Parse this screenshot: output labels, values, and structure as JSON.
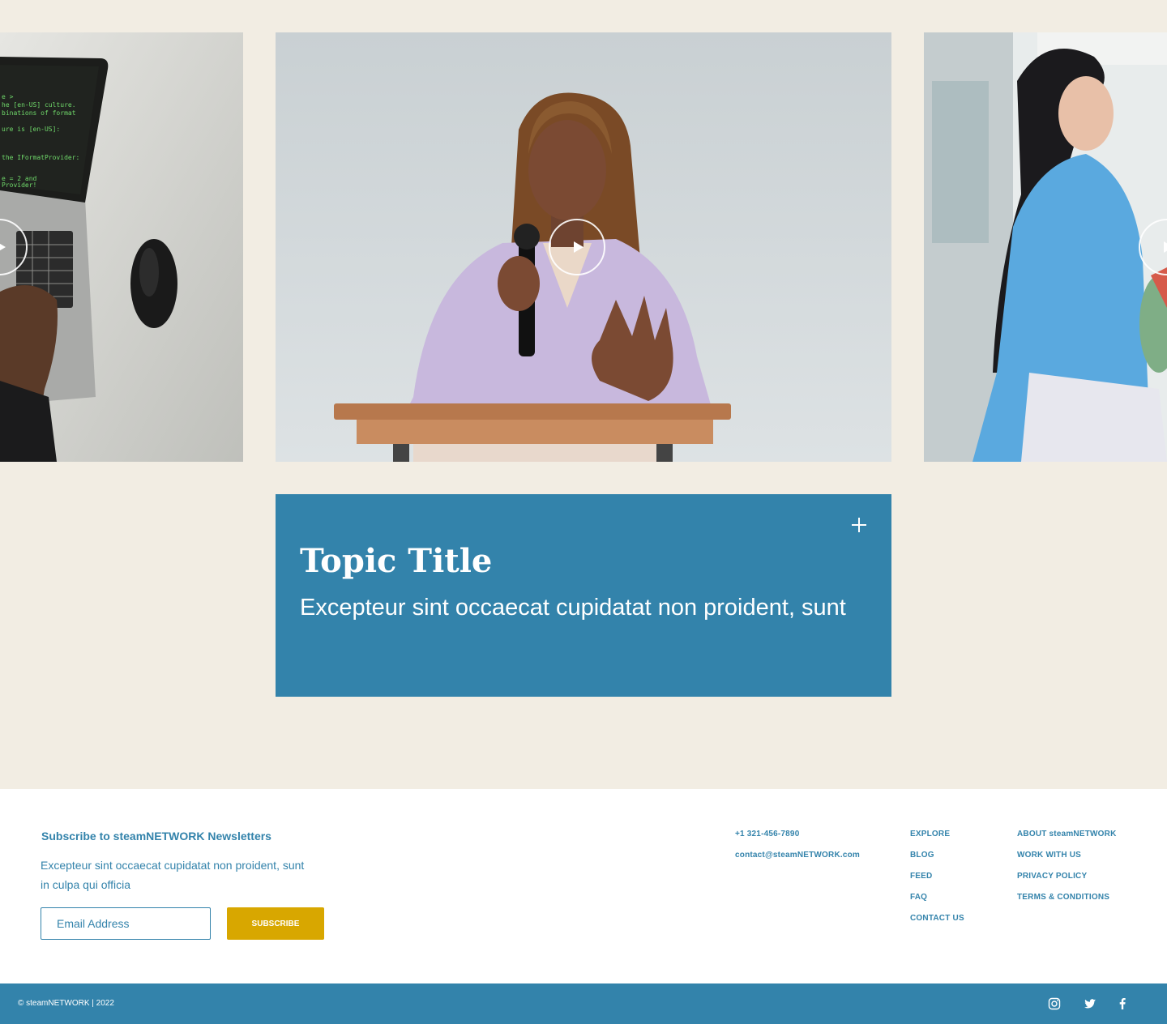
{
  "carousel": {
    "slides": [
      {
        "name": "laptop-coding",
        "play_icon": "play-icon"
      },
      {
        "name": "woman-speaking-at-podium",
        "play_icon": "play-icon"
      },
      {
        "name": "woman-in-blue-shirt",
        "play_icon": "play-icon"
      }
    ]
  },
  "topic": {
    "title": "Topic Title",
    "description": "Excepteur sint occaecat cupidatat non proident, sunt",
    "expand_icon": "plus-icon"
  },
  "newsletter": {
    "title": "Subscribe to steamNETWORK Newsletters",
    "description": "Excepteur sint occaecat cupidatat non proident, sunt in culpa qui officia",
    "email_placeholder": "Email Address",
    "subscribe_label": "SUBSCRIBE"
  },
  "contact": {
    "phone": "+1 321-456-7890",
    "email": "contact@steamNETWORK.com"
  },
  "nav_primary": [
    "EXPLORE",
    "BLOG",
    "FEED",
    "FAQ",
    "CONTACT US"
  ],
  "nav_secondary": [
    "ABOUT steamNETWORK",
    "WORK WITH US",
    "PRIVACY POLICY",
    "TERMS & CONDITIONS"
  ],
  "bottom": {
    "copyright": "© steamNETWORK | 2022",
    "social": [
      "instagram-icon",
      "twitter-icon",
      "facebook-icon"
    ]
  },
  "colors": {
    "background": "#f2ede3",
    "brand_blue": "#3383ab",
    "accent_gold": "#d8a700",
    "white": "#ffffff"
  }
}
